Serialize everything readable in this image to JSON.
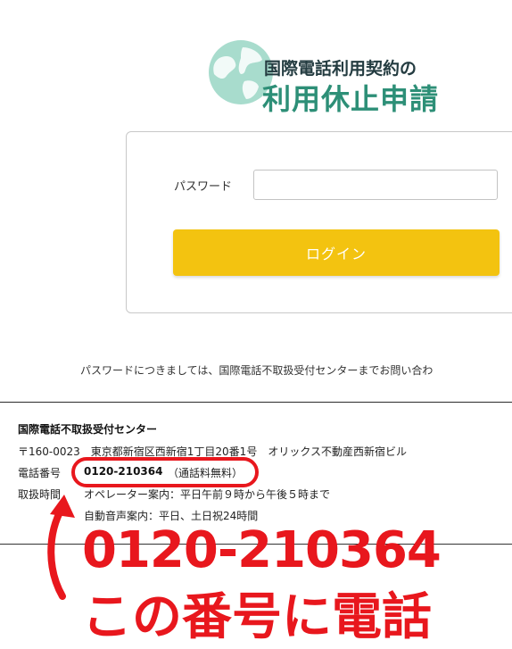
{
  "brand": {
    "title_line1": "国際電話利用契約の",
    "title_line2": "利用休止申請",
    "colors": {
      "dark": "#243c41",
      "green": "#2d8f77",
      "globe": "#9fd4c6"
    }
  },
  "login": {
    "password_label": "パスワード",
    "password_value": "",
    "button_label": "ログイン",
    "button_color": "#f3c310"
  },
  "notice": "パスワードにつきましては、国際電話不取扱受付センターまでお問い合わ",
  "contact": {
    "center_name": "国際電話不取扱受付センター",
    "address": "〒160-0023　東京都新宿区西新宿1丁目20番1号　オリックス不動産西新宿ビル",
    "tel_label": "電話番号",
    "tel_number": "0120-210364",
    "tel_note": "（通話料無料）",
    "hours_label": "取扱時間",
    "hours_operator": "オペレーター案内：平日午前９時から午後５時まで",
    "hours_auto": "自動音声案内：平日、土日祝24時間"
  },
  "annotation": {
    "big_number": "0120-210364",
    "big_text": "この番号に電話",
    "color": "#e8171d"
  }
}
